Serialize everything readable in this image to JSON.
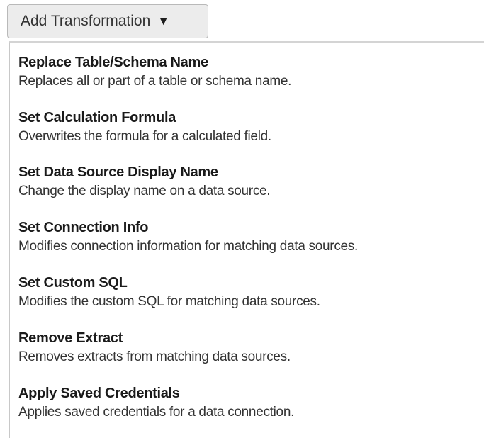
{
  "add_button": {
    "label": "Add Transformation",
    "caret_icon": "▼"
  },
  "menu": {
    "items": [
      {
        "title": "Replace Table/Schema Name",
        "description": "Replaces all or part of a table or schema name."
      },
      {
        "title": "Set Calculation Formula",
        "description": "Overwrites the formula for a calculated field."
      },
      {
        "title": "Set Data Source Display Name",
        "description": "Change the display name on a data source."
      },
      {
        "title": "Set Connection Info",
        "description": "Modifies connection information for matching data sources."
      },
      {
        "title": "Set Custom SQL",
        "description": "Modifies the custom SQL for matching data sources."
      },
      {
        "title": "Remove Extract",
        "description": "Removes extracts from matching data sources."
      },
      {
        "title": "Apply Saved Credentials",
        "description": "Applies saved credentials for a data connection."
      }
    ]
  }
}
